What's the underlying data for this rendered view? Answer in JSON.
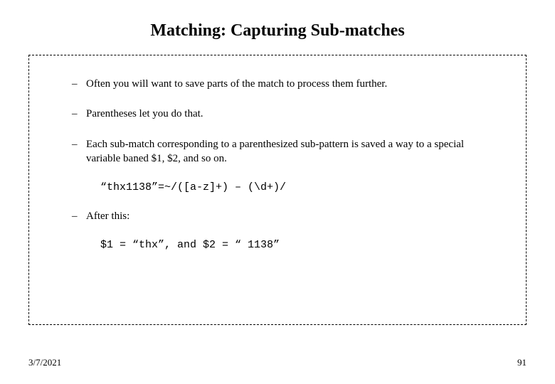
{
  "title": "Matching: Capturing Sub-matches",
  "bullets": {
    "b1": "Often you will want to save parts of the match to process them further.",
    "b2": "Parentheses let you do that.",
    "b3": "Each sub-match corresponding to a parenthesized sub-pattern is saved a way to a special variable baned $1, $2, and so on.",
    "code1": "“thx1138”=~/([a-z]+) – (\\d+)/",
    "b4": "After this:",
    "code2": "$1 = “thx”, and $2 = “ 1138”"
  },
  "dash": "–",
  "footer": {
    "date": "3/7/2021",
    "page": "91"
  }
}
